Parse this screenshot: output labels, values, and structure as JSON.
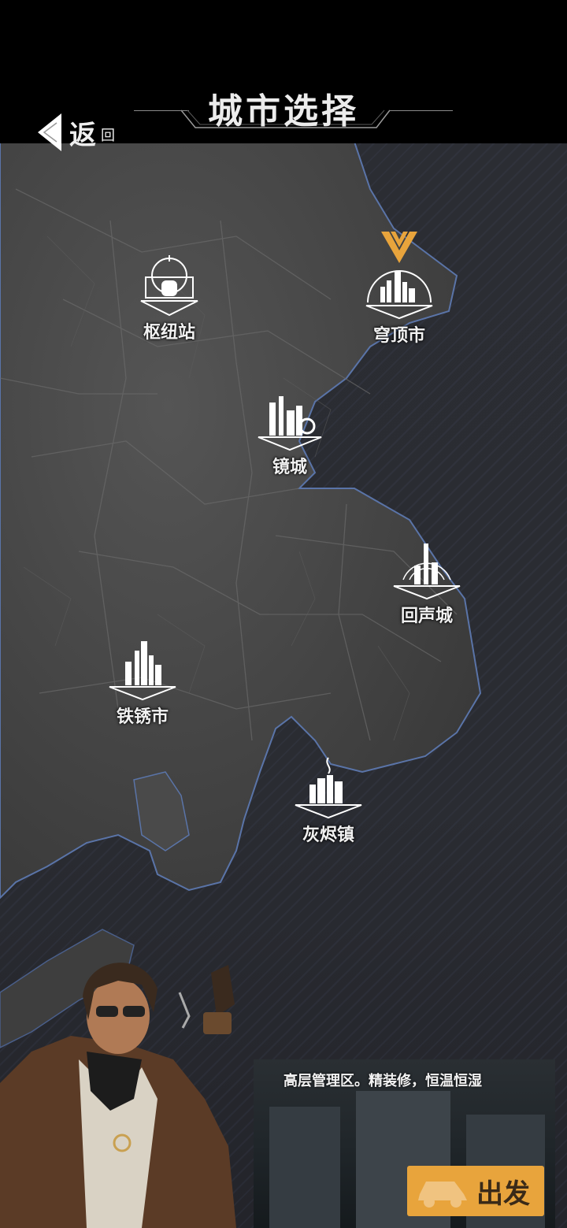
{
  "header": {
    "title": "城市选择",
    "back_label": "返",
    "back_sub": "回"
  },
  "cities": [
    {
      "id": "hub",
      "name": "枢纽站"
    },
    {
      "id": "dome",
      "name": "穹顶市",
      "selected": true
    },
    {
      "id": "mirror",
      "name": "镜城"
    },
    {
      "id": "echo",
      "name": "回声城"
    },
    {
      "id": "rust",
      "name": "铁锈市"
    },
    {
      "id": "ash",
      "name": "灰烬镇"
    }
  ],
  "info": {
    "description": "高层管理区。精装修，恒温恒湿"
  },
  "action": {
    "go_label": "出发"
  },
  "colors": {
    "accent": "#e8a43c",
    "land": "#4a4a4a",
    "sea": "#2a2c32",
    "coast": "#5a74a8"
  }
}
